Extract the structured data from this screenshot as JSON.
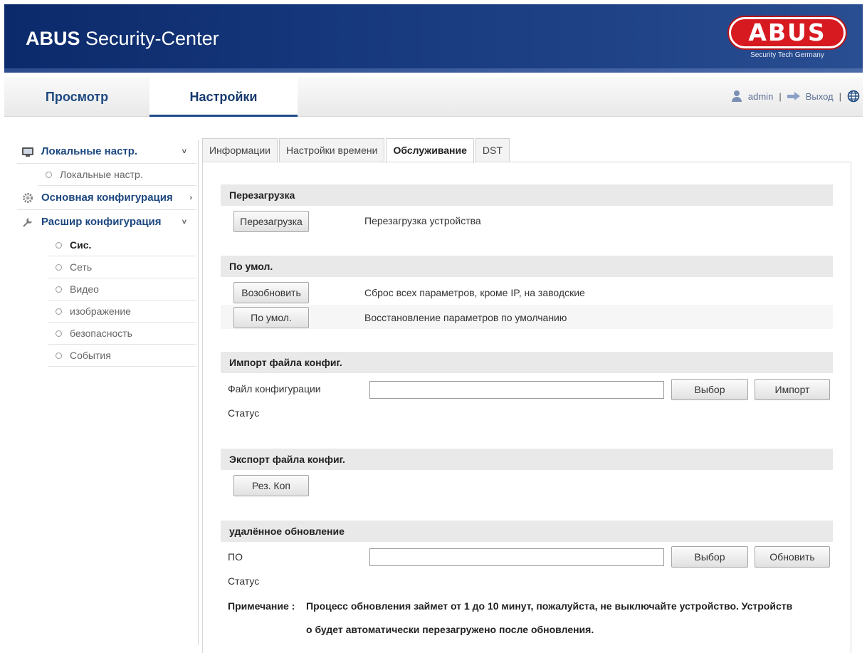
{
  "header": {
    "title_bold": "ABUS",
    "title_rest": " Security-Center",
    "logo_text": "ABUS",
    "logo_sub": "Security Tech Germany"
  },
  "nav": {
    "tab_view": "Просмотр",
    "tab_settings": "Настройки",
    "user": "admin",
    "sep": "|",
    "logout": "Выход"
  },
  "sidebar": {
    "local": {
      "label": "Локальные настр.",
      "chevron": "˅",
      "items": [
        "Локальные настр."
      ]
    },
    "basic": {
      "label": "Основная конфигурация",
      "chevron": "›"
    },
    "advanced": {
      "label": "Расшир конфигурация",
      "chevron": "˅",
      "items": [
        "Сис.",
        "Сеть",
        "Видео",
        "изображение",
        "безопасность",
        "События"
      ]
    }
  },
  "tabs": [
    "Информации",
    "Настройки времени",
    "Обслуживание",
    "DST"
  ],
  "sections": {
    "reboot": {
      "title": "Перезагрузка",
      "button": "Перезагрузка",
      "desc": "Перезагрузка устройства"
    },
    "default": {
      "title": "По умол.",
      "restore_button": "Возобновить",
      "restore_desc": "Сброс всех параметров, кроме IP, на заводские",
      "default_button": "По умол.",
      "default_desc": "Восстановление параметров по умолчанию"
    },
    "import": {
      "title": "Импорт файла конфиг.",
      "file_label": "Файл конфигурации",
      "file_value": "",
      "browse": "Выбор",
      "import": "Импорт",
      "status": "Статус"
    },
    "export": {
      "title": "Экспорт файла конфиг.",
      "backup": "Рез. Коп"
    },
    "upgrade": {
      "title": "удалённое обновление",
      "fw_label": "ПО",
      "fw_value": "",
      "browse": "Выбор",
      "update": "Обновить",
      "status": "Статус",
      "note_label": "Примечание :",
      "note_line1": "Процесс обновления займет от 1 до 10 минут, пожалуйста, не выключайте устройство. Устройств",
      "note_line2": "о будет автоматически перезагружено после обновления."
    }
  }
}
